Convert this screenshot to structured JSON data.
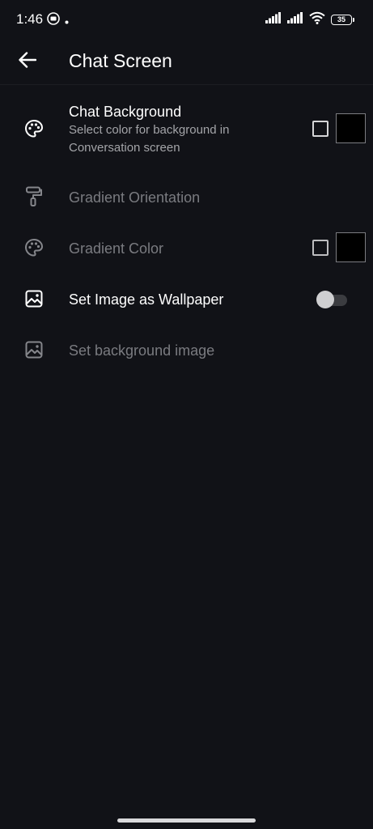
{
  "status_bar": {
    "time": "1:46",
    "battery_level": "35",
    "icons": [
      "notification-app-icon",
      "dot-icon",
      "signal-icon",
      "signal-icon",
      "wifi-icon",
      "battery-icon"
    ]
  },
  "app_bar": {
    "title": "Chat Screen",
    "back_icon": "arrow-back-icon"
  },
  "settings": {
    "chat_background": {
      "title": "Chat Background",
      "subtitle": "Select color for background in Conversation screen",
      "icon": "palette-icon",
      "checked": false,
      "swatch_color": "#000000",
      "enabled": true
    },
    "gradient_orientation": {
      "title": "Gradient Orientation",
      "icon": "paint-roller-icon",
      "enabled": false
    },
    "gradient_color": {
      "title": "Gradient Color",
      "icon": "palette-icon",
      "checked": false,
      "swatch_color": "#000000",
      "enabled": false
    },
    "image_wallpaper": {
      "title": "Set Image as Wallpaper",
      "icon": "image-icon",
      "toggle_on": false,
      "enabled": true
    },
    "background_image": {
      "title": "Set background image",
      "icon": "image-icon",
      "enabled": false
    }
  },
  "colors": {
    "background": "#111217",
    "text_primary": "#ffffff",
    "text_secondary": "#a3a4a8",
    "text_disabled": "#7a7b80"
  }
}
